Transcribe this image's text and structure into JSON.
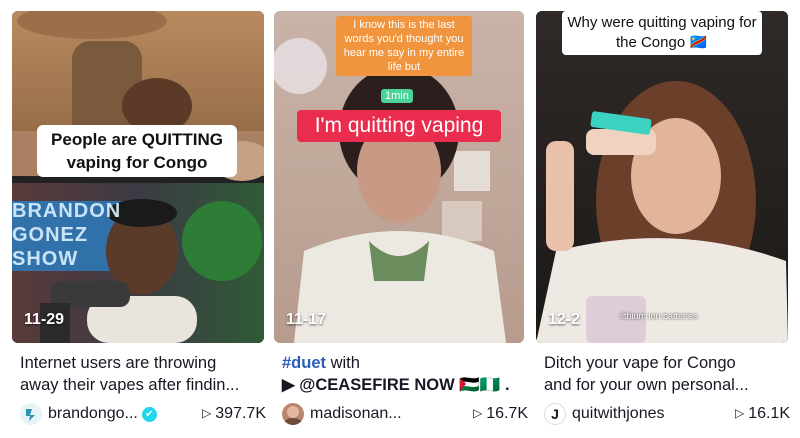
{
  "videos": [
    {
      "top_caption": "People are QUITTING vaping for Congo",
      "bottom_sign": "BRANDON GONEZ SHOW",
      "date": "11-29",
      "desc_line1": "Internet users are throwing",
      "desc_line2": "away their vapes after findin...",
      "username": "brandongo...",
      "views": "397.7K"
    },
    {
      "overlay_text": "I know this is the last words you'd thought you hear me say in my entire life but",
      "duration_badge": "1min",
      "main_caption": "I'm quitting vaping",
      "date": "11-17",
      "desc_tag": "#duet",
      "desc_line1_rest": " with",
      "desc_line2": "▶ @CEASEFIRE NOW 🇵🇸🇳🇬 .",
      "username": "madisonan...",
      "views": "16.7K"
    },
    {
      "overlay_text": "Why were quitting vaping for the Congo 🇨🇩",
      "inner_caption": "lithium ion batteries",
      "date": "12-2",
      "desc_line1": "Ditch your vape for Congo",
      "desc_line2": "and for your own personal...",
      "avatar_letter": "J",
      "username": "quitwithjones",
      "views": "16.1K"
    }
  ],
  "icons": {
    "play": "play-icon",
    "verified": "verified-badge-icon"
  },
  "colors": {
    "tag": "#2b5db9",
    "badge_green": "#4cd39b",
    "caption_red": "#ea2d4f",
    "overlay_orange": "#f0943d"
  }
}
